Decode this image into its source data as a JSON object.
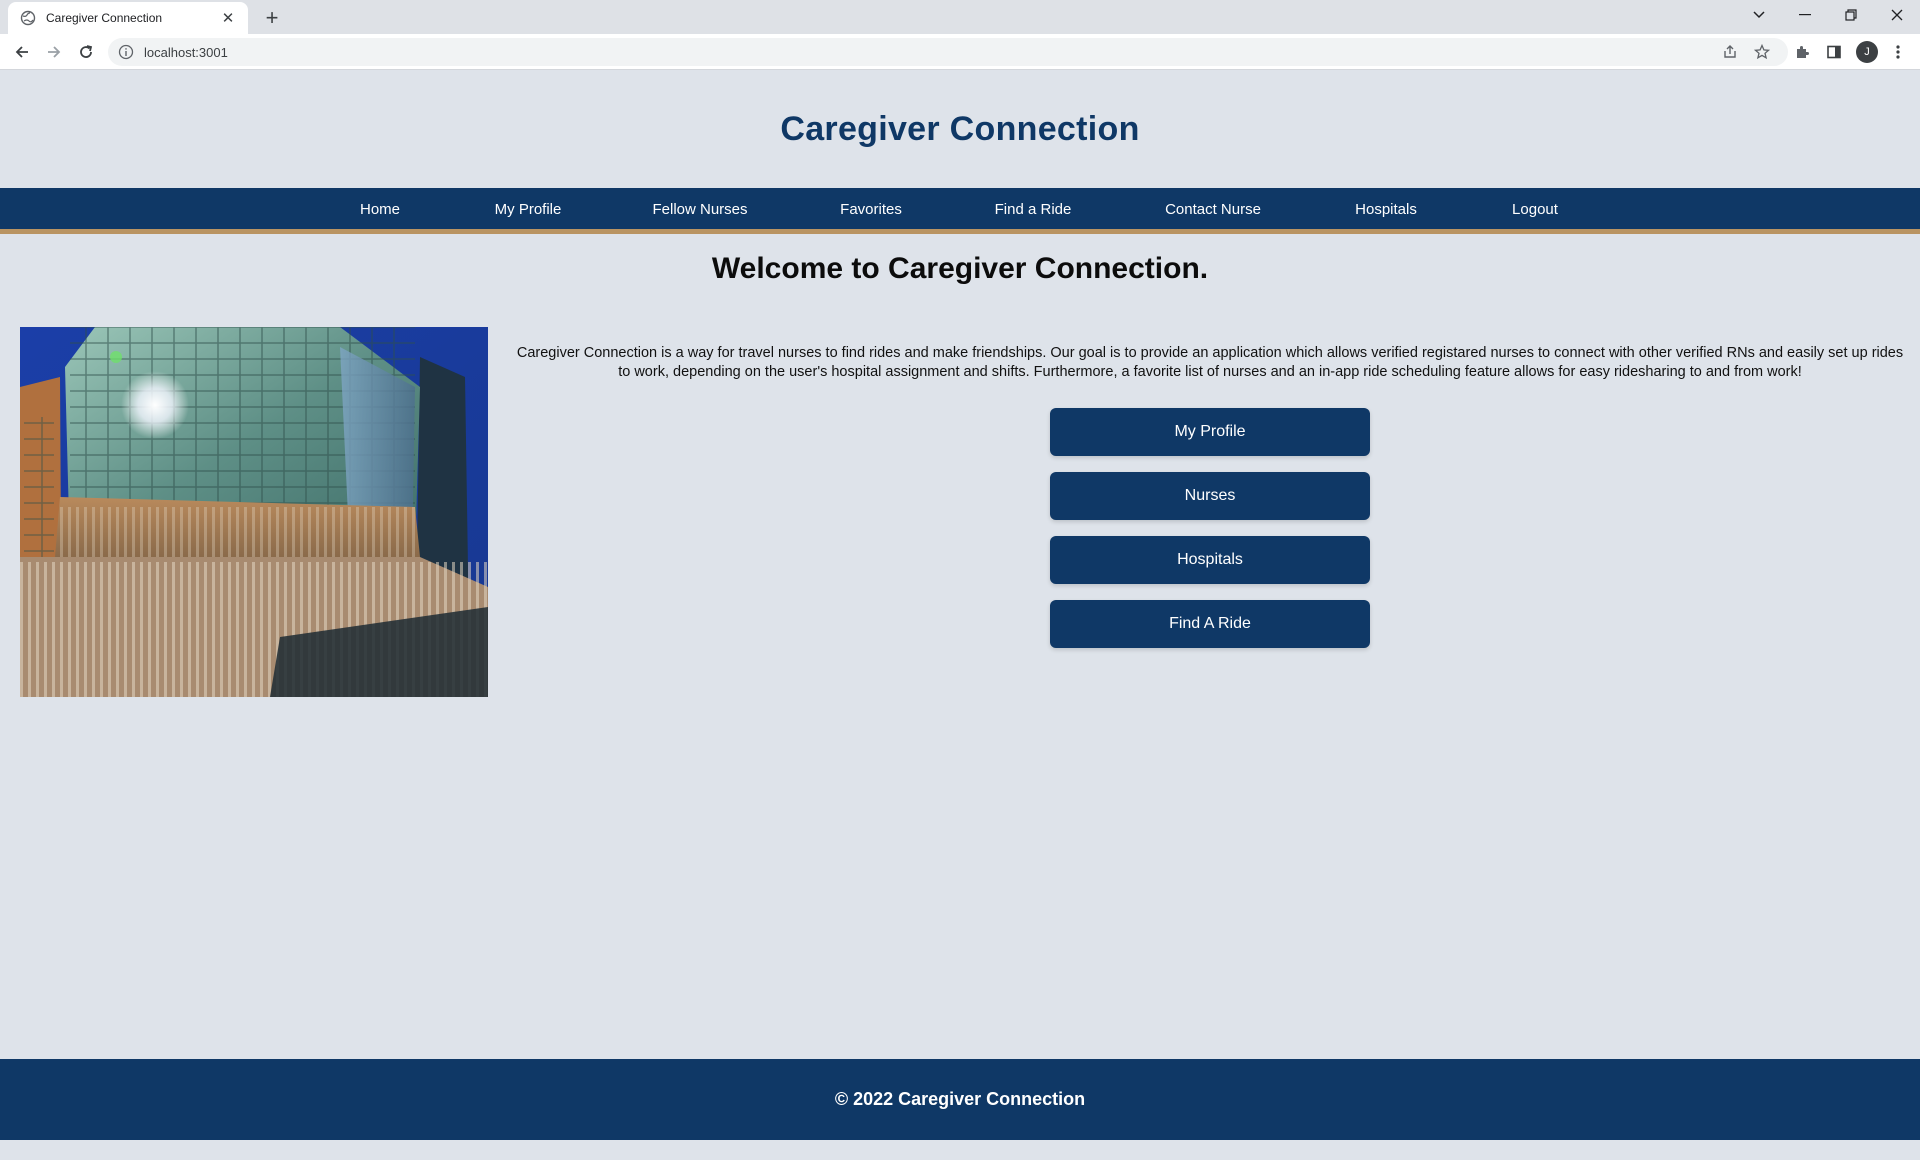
{
  "browser": {
    "tab_title": "Caregiver Connection",
    "url": "localhost:3001",
    "profile_initial": "J"
  },
  "site": {
    "title": "Caregiver Connection"
  },
  "nav": {
    "items": [
      {
        "label": "Home"
      },
      {
        "label": "My Profile"
      },
      {
        "label": "Fellow Nurses"
      },
      {
        "label": "Favorites"
      },
      {
        "label": "Find a Ride"
      },
      {
        "label": "Contact Nurse"
      },
      {
        "label": "Hospitals"
      },
      {
        "label": "Logout"
      }
    ]
  },
  "main": {
    "heading": "Welcome to Caregiver Connection.",
    "intro": "Caregiver Connection is a way for travel nurses to find rides and make friendships. Our goal is to provide an application which allows verified registared nurses to connect with other verified RNs and easily set up rides to work, depending on the user's hospital assignment and shifts. Furthermore, a favorite list of nurses and an in-app ride scheduling feature allows for easy ridesharing to and from work!",
    "buttons": [
      {
        "label": "My Profile"
      },
      {
        "label": "Nurses"
      },
      {
        "label": "Hospitals"
      },
      {
        "label": "Find A Ride"
      }
    ]
  },
  "footer": {
    "text": "© 2022 Caregiver Connection"
  },
  "colors": {
    "brand_navy": "#0f3866",
    "accent_gold": "#b99462",
    "page_bg": "#dee3ea"
  }
}
